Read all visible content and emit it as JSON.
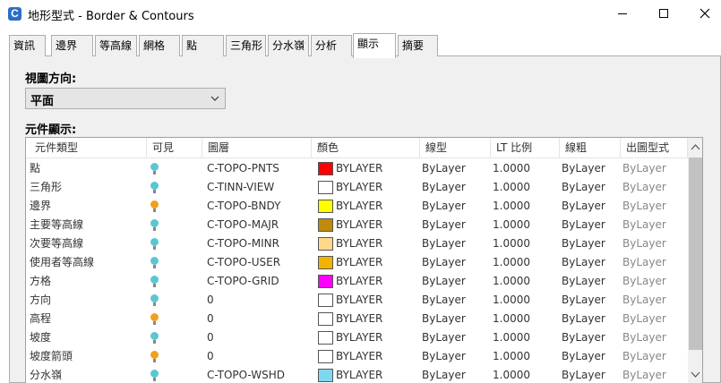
{
  "window": {
    "app_icon_letter": "C",
    "title": "地形型式 - Border & Contours"
  },
  "tabs": [
    {
      "label": "資訊"
    },
    {
      "label": "邊界"
    },
    {
      "label": "等高線"
    },
    {
      "label": "網格"
    },
    {
      "label": "點"
    },
    {
      "label": "三角形"
    },
    {
      "label": "分水嶺"
    },
    {
      "label": "分析"
    },
    {
      "label": "顯示"
    },
    {
      "label": "摘要"
    }
  ],
  "active_tab": "顯示",
  "view_direction": {
    "label": "視圖方向:",
    "value": "平面"
  },
  "component_display": {
    "label": "元件顯示:",
    "columns": [
      "元件類型",
      "可見",
      "圖層",
      "顏色",
      "線型",
      "LT 比例",
      "線粗",
      "出圖型式"
    ],
    "rows": [
      {
        "type": "點",
        "visible": true,
        "layer": "C-TOPO-PNTS",
        "color": "#ff0000",
        "color_label": "BYLAYER",
        "linetype": "ByLayer",
        "lt_scale": "1.0000",
        "lineweight": "ByLayer",
        "plot_style": "ByLayer"
      },
      {
        "type": "三角形",
        "visible": true,
        "layer": "C-TINN-VIEW",
        "color": "#ffffff",
        "color_label": "BYLAYER",
        "linetype": "ByLayer",
        "lt_scale": "1.0000",
        "lineweight": "ByLayer",
        "plot_style": "ByLayer"
      },
      {
        "type": "邊界",
        "visible": false,
        "layer": "C-TOPO-BNDY",
        "color": "#ffff00",
        "color_label": "BYLAYER",
        "linetype": "ByLayer",
        "lt_scale": "1.0000",
        "lineweight": "ByLayer",
        "plot_style": "ByLayer"
      },
      {
        "type": "主要等高線",
        "visible": true,
        "layer": "C-TOPO-MAJR",
        "color": "#c08a0a",
        "color_label": "BYLAYER",
        "linetype": "ByLayer",
        "lt_scale": "1.0000",
        "lineweight": "ByLayer",
        "plot_style": "ByLayer"
      },
      {
        "type": "次要等高線",
        "visible": true,
        "layer": "C-TOPO-MINR",
        "color": "#ffd98a",
        "color_label": "BYLAYER",
        "linetype": "ByLayer",
        "lt_scale": "1.0000",
        "lineweight": "ByLayer",
        "plot_style": "ByLayer"
      },
      {
        "type": "使用者等高線",
        "visible": true,
        "layer": "C-TOPO-USER",
        "color": "#f0b400",
        "color_label": "BYLAYER",
        "linetype": "ByLayer",
        "lt_scale": "1.0000",
        "lineweight": "ByLayer",
        "plot_style": "ByLayer"
      },
      {
        "type": "方格",
        "visible": true,
        "layer": "C-TOPO-GRID",
        "color": "#ff00ff",
        "color_label": "BYLAYER",
        "linetype": "ByLayer",
        "lt_scale": "1.0000",
        "lineweight": "ByLayer",
        "plot_style": "ByLayer"
      },
      {
        "type": "方向",
        "visible": true,
        "layer": "0",
        "color": "#ffffff",
        "color_label": "BYLAYER",
        "linetype": "ByLayer",
        "lt_scale": "1.0000",
        "lineweight": "ByLayer",
        "plot_style": "ByLayer"
      },
      {
        "type": "高程",
        "visible": false,
        "layer": "0",
        "color": "#ffffff",
        "color_label": "BYLAYER",
        "linetype": "ByLayer",
        "lt_scale": "1.0000",
        "lineweight": "ByLayer",
        "plot_style": "ByLayer"
      },
      {
        "type": "坡度",
        "visible": true,
        "layer": "0",
        "color": "#ffffff",
        "color_label": "BYLAYER",
        "linetype": "ByLayer",
        "lt_scale": "1.0000",
        "lineweight": "ByLayer",
        "plot_style": "ByLayer"
      },
      {
        "type": "坡度箭頭",
        "visible": false,
        "layer": "0",
        "color": "#ffffff",
        "color_label": "BYLAYER",
        "linetype": "ByLayer",
        "lt_scale": "1.0000",
        "lineweight": "ByLayer",
        "plot_style": "ByLayer"
      },
      {
        "type": "分水嶺",
        "visible": true,
        "layer": "C-TOPO-WSHD",
        "color": "#80d8f0",
        "color_label": "BYLAYER",
        "linetype": "ByLayer",
        "lt_scale": "1.0000",
        "lineweight": "ByLayer",
        "plot_style": "ByLayer"
      }
    ]
  },
  "colors": {
    "visible_on": "#5bc6d0",
    "visible_off": "#f0a020"
  },
  "icons": {
    "minimize": "minimize-icon",
    "maximize": "maximize-icon",
    "close": "close-icon",
    "dropdown": "chevron-down-icon",
    "visibility": "lightbulb-icon"
  }
}
